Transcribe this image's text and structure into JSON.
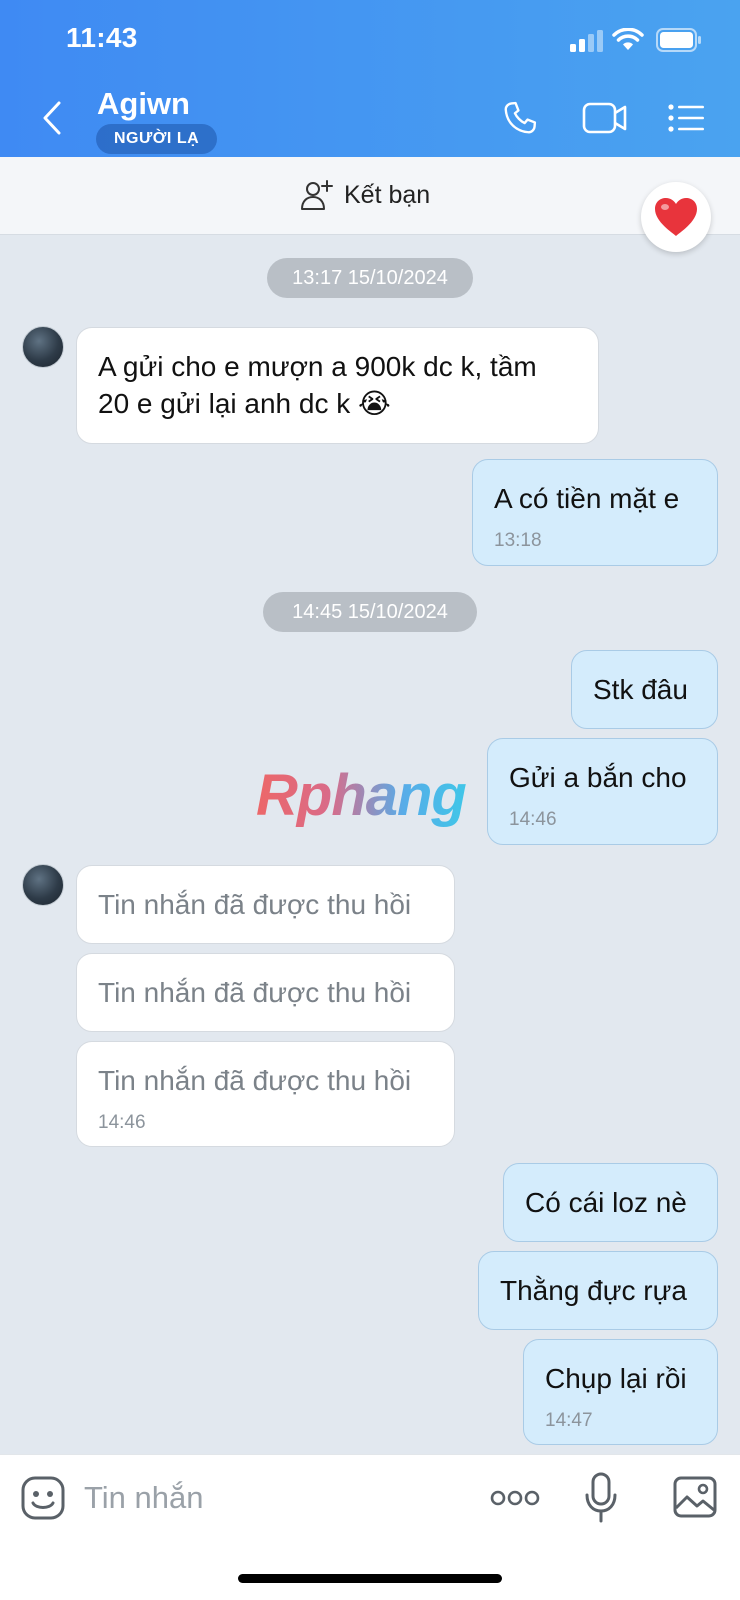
{
  "status_bar": {
    "time": "11:43"
  },
  "header": {
    "contact_name": "Agiwn",
    "badge": "NGƯỜI LẠ",
    "icons": [
      "back-icon",
      "phone-icon",
      "video-camera-icon",
      "list-menu-icon"
    ]
  },
  "friend_bar": {
    "add_friend_label": "Kết bạn",
    "heart_icon": "heart-icon"
  },
  "chat": {
    "date_1": "13:17 15/10/2024",
    "date_2": "14:45 15/10/2024",
    "messages": [
      {
        "from": "them",
        "line1": "A gửi cho e mượn a 900k dc k, tầm",
        "line2": "20 e gửi lại anh dc k",
        "emoji": "😭"
      },
      {
        "from": "me",
        "text": "A có tiền mặt e",
        "time": "13:18"
      },
      {
        "from": "me",
        "text": "Stk đâu"
      },
      {
        "from": "me",
        "text": "Gửi a bắn cho",
        "time": "14:46"
      },
      {
        "from": "them",
        "text": "Tin nhắn đã được thu hồi"
      },
      {
        "from": "them",
        "text": "Tin nhắn đã được thu hồi"
      },
      {
        "from": "them",
        "text": "Tin nhắn đã được thu hồi",
        "time": "14:46"
      },
      {
        "from": "me",
        "text": "Có cái loz nè"
      },
      {
        "from": "me",
        "text": "Thằng đực rựa"
      },
      {
        "from": "me",
        "text": "Chụp lại rồi",
        "time": "14:47"
      }
    ]
  },
  "watermark": "Rphang",
  "input_bar": {
    "placeholder": "Tin nhắn",
    "more_label": "ooo"
  },
  "colors": {
    "header_start": "#3f8af3",
    "header_end": "#4aa3f0",
    "chat_background": "#e2e8ef",
    "outgoing_bubble": "#d4ecfc",
    "incoming_bubble": "#ffffff"
  }
}
